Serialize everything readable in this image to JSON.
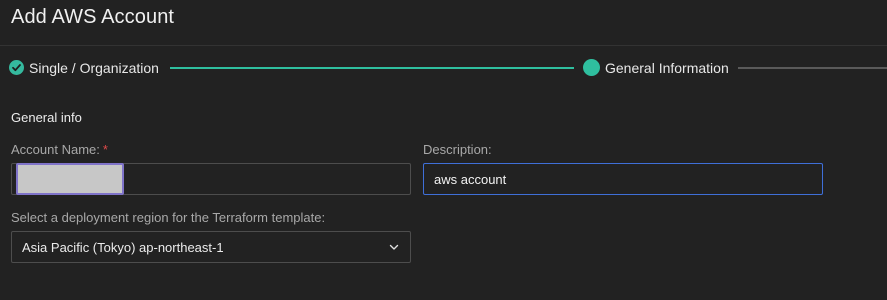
{
  "header": {
    "title": "Add AWS Account"
  },
  "stepper": {
    "steps": [
      {
        "label": "Single / Organization",
        "status": "completed"
      },
      {
        "label": "General Information",
        "status": "current"
      }
    ]
  },
  "form": {
    "section_title": "General info",
    "account_name": {
      "label": "Account Name:",
      "required_mark": "*",
      "value": ""
    },
    "description": {
      "label": "Description:",
      "value": "aws account"
    },
    "region": {
      "label": "Select a deployment region for the Terraform template:",
      "selected": "Asia Pacific (Tokyo) ap-northeast-1"
    }
  },
  "colors": {
    "accent": "#2fbf9f",
    "focus_border": "#3f6fd8",
    "required": "#e04a4a",
    "background": "#222222"
  },
  "icons": {
    "completed_step": "check-icon",
    "current_step": "dot-icon",
    "dropdown": "chevron-down-icon"
  }
}
